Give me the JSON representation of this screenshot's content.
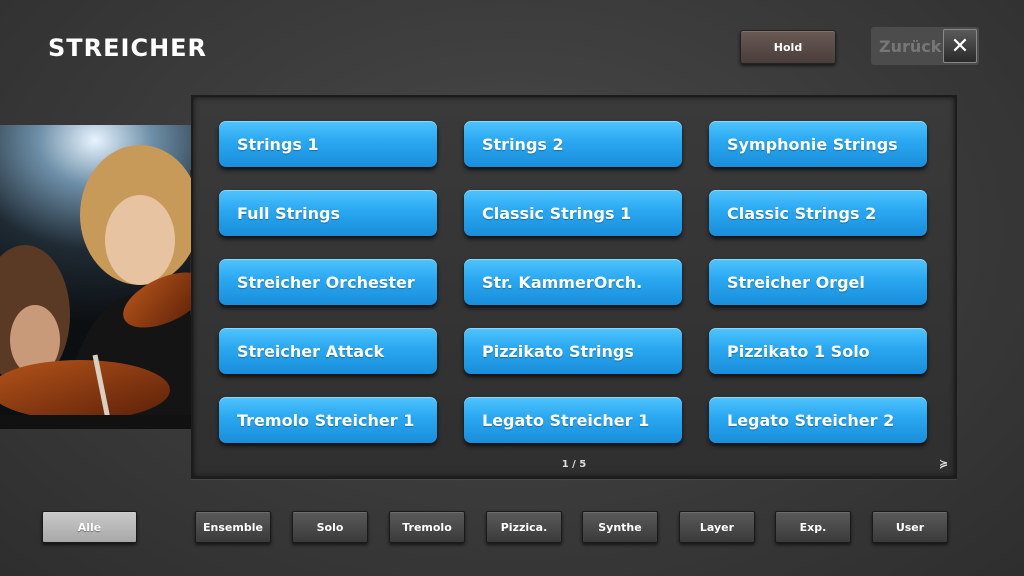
{
  "header": {
    "title": "STREICHER",
    "hold_label": "Hold",
    "back_label": "Zurück",
    "close_glyph": "✕"
  },
  "sounds": [
    "Strings 1",
    "Strings 2",
    "Symphonie Strings",
    "Full Strings",
    "Classic Strings 1",
    "Classic Strings 2",
    "Streicher Orchester",
    "Str. KammerOrch.",
    "Streicher Orgel",
    "Streicher Attack",
    "Pizzikato Strings",
    "Pizzikato 1 Solo",
    "Tremolo Streicher 1",
    "Legato Streicher 1",
    "Legato Streicher 2"
  ],
  "pagination": {
    "page_text": "1 / 5",
    "next_glyph": "≽"
  },
  "filters": {
    "active": "Alle",
    "items": [
      "Ensemble",
      "Solo",
      "Tremolo",
      "Pizzica.",
      "Synthe",
      "Layer",
      "Exp.",
      "User"
    ]
  },
  "colors": {
    "sound_button": "#2aa7f0",
    "active_filter": "#bdbdbd"
  }
}
